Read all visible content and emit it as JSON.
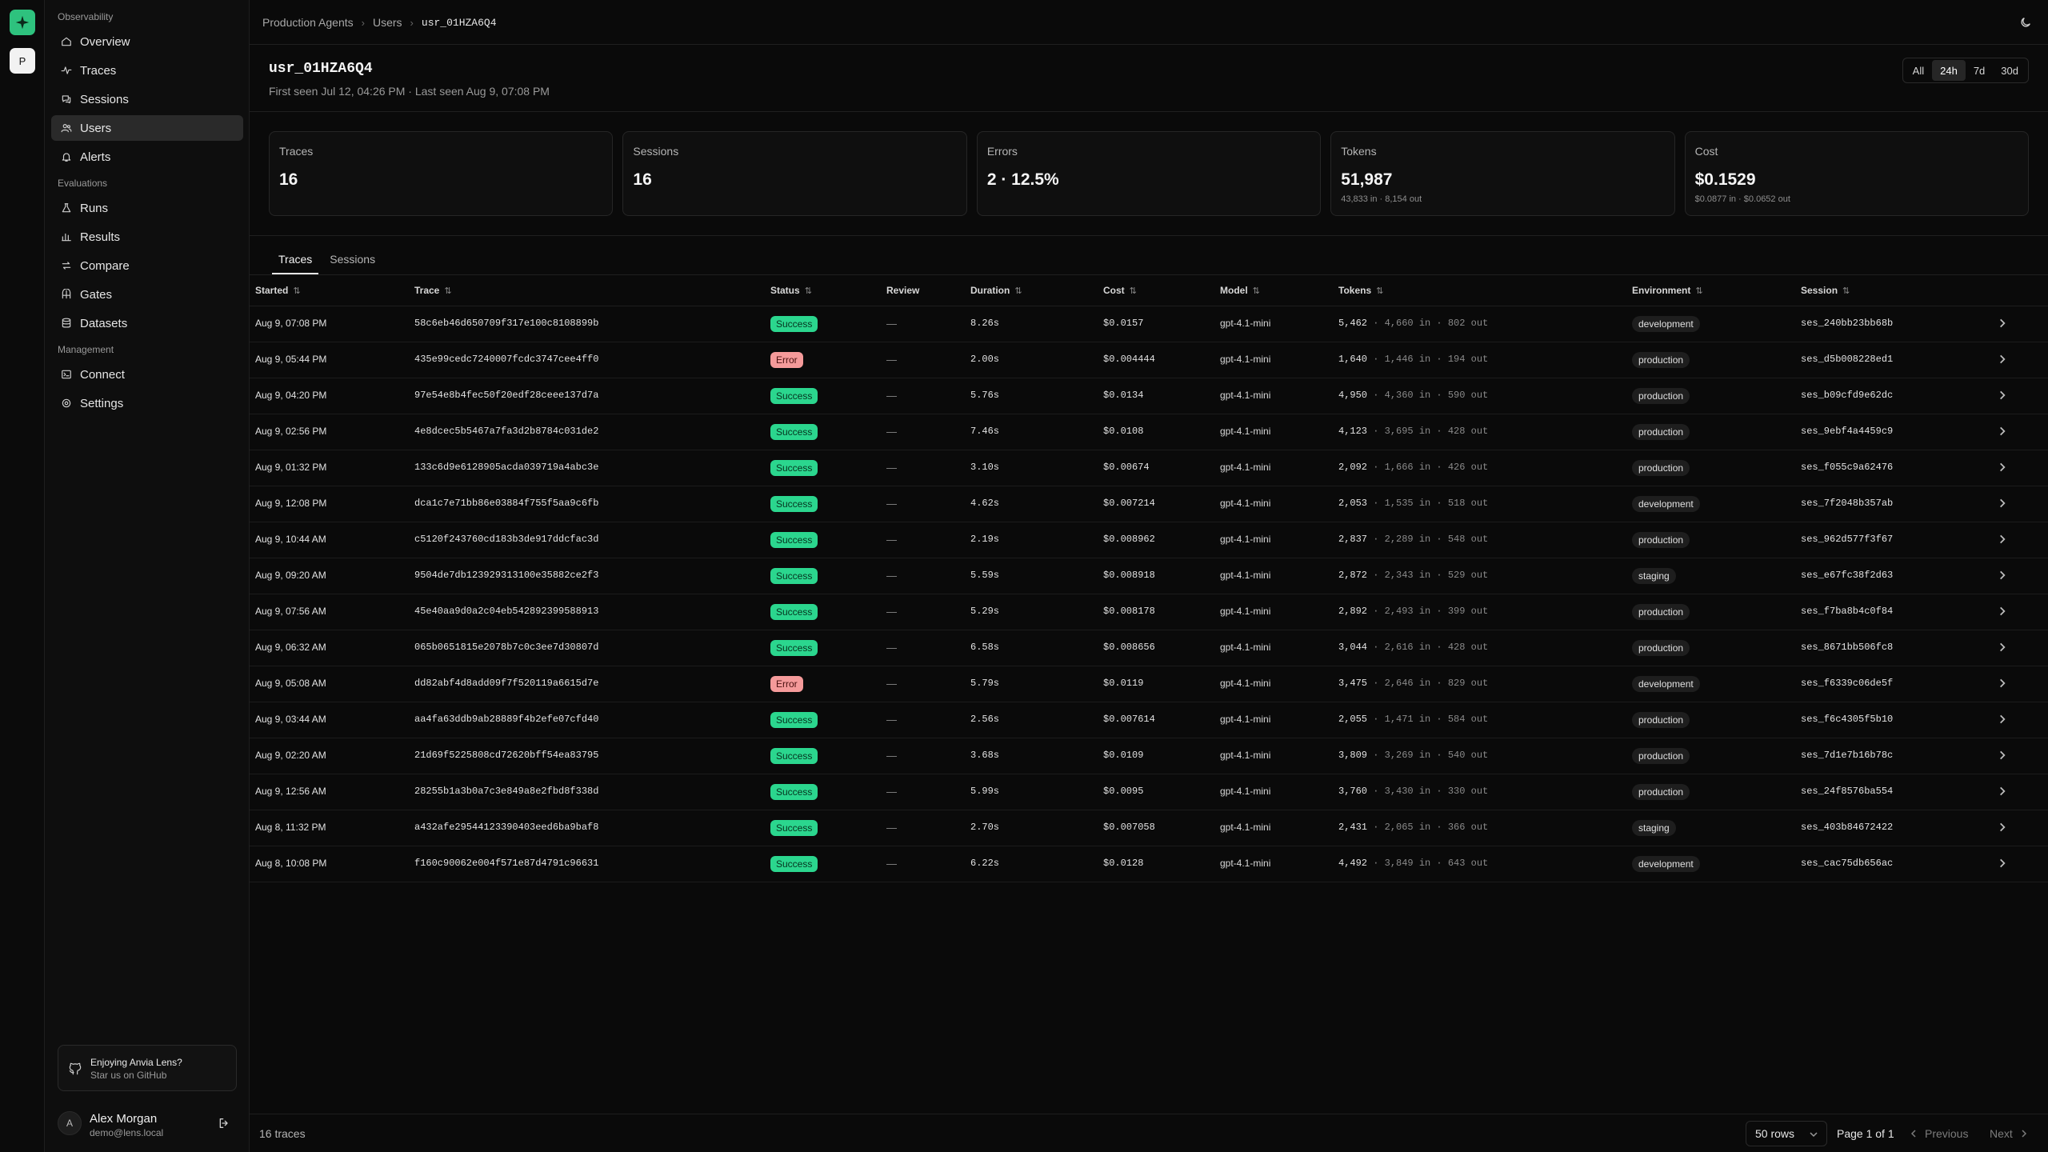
{
  "rail": {
    "project_initial": "P"
  },
  "sidebar": {
    "sections": [
      {
        "title": "Observability",
        "items": [
          {
            "label": "Overview",
            "icon": "home-icon"
          },
          {
            "label": "Traces",
            "icon": "activity-icon"
          },
          {
            "label": "Sessions",
            "icon": "chat-icon"
          },
          {
            "label": "Users",
            "icon": "users-icon",
            "active": true
          },
          {
            "label": "Alerts",
            "icon": "bell-icon"
          }
        ]
      },
      {
        "title": "Evaluations",
        "items": [
          {
            "label": "Runs",
            "icon": "flask-icon"
          },
          {
            "label": "Results",
            "icon": "bar-chart-icon"
          },
          {
            "label": "Compare",
            "icon": "compare-icon"
          },
          {
            "label": "Gates",
            "icon": "gate-icon"
          },
          {
            "label": "Datasets",
            "icon": "database-icon"
          }
        ]
      },
      {
        "title": "Management",
        "items": [
          {
            "label": "Connect",
            "icon": "terminal-icon"
          },
          {
            "label": "Settings",
            "icon": "gear-icon"
          }
        ]
      }
    ],
    "promo": {
      "title": "Enjoying Anvia Lens?",
      "subtitle": "Star us on GitHub"
    },
    "user": {
      "initial": "A",
      "name": "Alex Morgan",
      "email": "demo@lens.local"
    }
  },
  "breadcrumb": [
    "Production Agents",
    "Users",
    "usr_01HZA6Q4"
  ],
  "header": {
    "title": "usr_01HZA6Q4",
    "meta": "First seen Jul 12, 04:26 PM · Last seen Aug 9, 07:08 PM",
    "ranges": [
      "All",
      "24h",
      "7d",
      "30d"
    ],
    "selected_range": "24h"
  },
  "stats": [
    {
      "label": "Traces",
      "value": "16",
      "sub": ""
    },
    {
      "label": "Sessions",
      "value": "16",
      "sub": ""
    },
    {
      "label": "Errors",
      "value": "2 · 12.5%",
      "sub": ""
    },
    {
      "label": "Tokens",
      "value": "51,987",
      "sub": "43,833 in · 8,154 out"
    },
    {
      "label": "Cost",
      "value": "$0.1529",
      "sub": "$0.0877 in · $0.0652 out"
    }
  ],
  "tabs": [
    "Traces",
    "Sessions"
  ],
  "active_tab": "Traces",
  "table": {
    "columns": [
      {
        "label": "Started",
        "sortable": true
      },
      {
        "label": "Trace",
        "sortable": true
      },
      {
        "label": "Status",
        "sortable": true
      },
      {
        "label": "Review",
        "sortable": false
      },
      {
        "label": "Duration",
        "sortable": true
      },
      {
        "label": "Cost",
        "sortable": true
      },
      {
        "label": "Model",
        "sortable": true
      },
      {
        "label": "Tokens",
        "sortable": true
      },
      {
        "label": "Environment",
        "sortable": true
      },
      {
        "label": "Session",
        "sortable": true
      }
    ],
    "rows": [
      {
        "started": "Aug 9, 07:08 PM",
        "trace": "58c6eb46d650709f317e100c8108899b",
        "status": "Success",
        "review": "—",
        "duration": "8.26s",
        "cost": "$0.0157",
        "model": "gpt-4.1-mini",
        "tokens": "5,462",
        "tokens_in": "4,660 in",
        "tokens_out": "802 out",
        "environment": "development",
        "session": "ses_240bb23bb68b"
      },
      {
        "started": "Aug 9, 05:44 PM",
        "trace": "435e99cedc7240007fcdc3747cee4ff0",
        "status": "Error",
        "review": "—",
        "duration": "2.00s",
        "cost": "$0.004444",
        "model": "gpt-4.1-mini",
        "tokens": "1,640",
        "tokens_in": "1,446 in",
        "tokens_out": "194 out",
        "environment": "production",
        "session": "ses_d5b008228ed1"
      },
      {
        "started": "Aug 9, 04:20 PM",
        "trace": "97e54e8b4fec50f20edf28ceee137d7a",
        "status": "Success",
        "review": "—",
        "duration": "5.76s",
        "cost": "$0.0134",
        "model": "gpt-4.1-mini",
        "tokens": "4,950",
        "tokens_in": "4,360 in",
        "tokens_out": "590 out",
        "environment": "production",
        "session": "ses_b09cfd9e62dc"
      },
      {
        "started": "Aug 9, 02:56 PM",
        "trace": "4e8dcec5b5467a7fa3d2b8784c031de2",
        "status": "Success",
        "review": "—",
        "duration": "7.46s",
        "cost": "$0.0108",
        "model": "gpt-4.1-mini",
        "tokens": "4,123",
        "tokens_in": "3,695 in",
        "tokens_out": "428 out",
        "environment": "production",
        "session": "ses_9ebf4a4459c9"
      },
      {
        "started": "Aug 9, 01:32 PM",
        "trace": "133c6d9e6128905acda039719a4abc3e",
        "status": "Success",
        "review": "—",
        "duration": "3.10s",
        "cost": "$0.00674",
        "model": "gpt-4.1-mini",
        "tokens": "2,092",
        "tokens_in": "1,666 in",
        "tokens_out": "426 out",
        "environment": "production",
        "session": "ses_f055c9a62476"
      },
      {
        "started": "Aug 9, 12:08 PM",
        "trace": "dca1c7e71bb86e03884f755f5aa9c6fb",
        "status": "Success",
        "review": "—",
        "duration": "4.62s",
        "cost": "$0.007214",
        "model": "gpt-4.1-mini",
        "tokens": "2,053",
        "tokens_in": "1,535 in",
        "tokens_out": "518 out",
        "environment": "development",
        "session": "ses_7f2048b357ab"
      },
      {
        "started": "Aug 9, 10:44 AM",
        "trace": "c5120f243760cd183b3de917ddcfac3d",
        "status": "Success",
        "review": "—",
        "duration": "2.19s",
        "cost": "$0.008962",
        "model": "gpt-4.1-mini",
        "tokens": "2,837",
        "tokens_in": "2,289 in",
        "tokens_out": "548 out",
        "environment": "production",
        "session": "ses_962d577f3f67"
      },
      {
        "started": "Aug 9, 09:20 AM",
        "trace": "9504de7db123929313100e35882ce2f3",
        "status": "Success",
        "review": "—",
        "duration": "5.59s",
        "cost": "$0.008918",
        "model": "gpt-4.1-mini",
        "tokens": "2,872",
        "tokens_in": "2,343 in",
        "tokens_out": "529 out",
        "environment": "staging",
        "session": "ses_e67fc38f2d63"
      },
      {
        "started": "Aug 9, 07:56 AM",
        "trace": "45e40aa9d0a2c04eb542892399588913",
        "status": "Success",
        "review": "—",
        "duration": "5.29s",
        "cost": "$0.008178",
        "model": "gpt-4.1-mini",
        "tokens": "2,892",
        "tokens_in": "2,493 in",
        "tokens_out": "399 out",
        "environment": "production",
        "session": "ses_f7ba8b4c0f84"
      },
      {
        "started": "Aug 9, 06:32 AM",
        "trace": "065b0651815e2078b7c0c3ee7d30807d",
        "status": "Success",
        "review": "—",
        "duration": "6.58s",
        "cost": "$0.008656",
        "model": "gpt-4.1-mini",
        "tokens": "3,044",
        "tokens_in": "2,616 in",
        "tokens_out": "428 out",
        "environment": "production",
        "session": "ses_8671bb506fc8"
      },
      {
        "started": "Aug 9, 05:08 AM",
        "trace": "dd82abf4d8add09f7f520119a6615d7e",
        "status": "Error",
        "review": "—",
        "duration": "5.79s",
        "cost": "$0.0119",
        "model": "gpt-4.1-mini",
        "tokens": "3,475",
        "tokens_in": "2,646 in",
        "tokens_out": "829 out",
        "environment": "development",
        "session": "ses_f6339c06de5f"
      },
      {
        "started": "Aug 9, 03:44 AM",
        "trace": "aa4fa63ddb9ab28889f4b2efe07cfd40",
        "status": "Success",
        "review": "—",
        "duration": "2.56s",
        "cost": "$0.007614",
        "model": "gpt-4.1-mini",
        "tokens": "2,055",
        "tokens_in": "1,471 in",
        "tokens_out": "584 out",
        "environment": "production",
        "session": "ses_f6c4305f5b10"
      },
      {
        "started": "Aug 9, 02:20 AM",
        "trace": "21d69f5225808cd72620bff54ea83795",
        "status": "Success",
        "review": "—",
        "duration": "3.68s",
        "cost": "$0.0109",
        "model": "gpt-4.1-mini",
        "tokens": "3,809",
        "tokens_in": "3,269 in",
        "tokens_out": "540 out",
        "environment": "production",
        "session": "ses_7d1e7b16b78c"
      },
      {
        "started": "Aug 9, 12:56 AM",
        "trace": "28255b1a3b0a7c3e849a8e2fbd8f338d",
        "status": "Success",
        "review": "—",
        "duration": "5.99s",
        "cost": "$0.0095",
        "model": "gpt-4.1-mini",
        "tokens": "3,760",
        "tokens_in": "3,430 in",
        "tokens_out": "330 out",
        "environment": "production",
        "session": "ses_24f8576ba554"
      },
      {
        "started": "Aug 8, 11:32 PM",
        "trace": "a432afe29544123390403eed6ba9baf8",
        "status": "Success",
        "review": "—",
        "duration": "2.70s",
        "cost": "$0.007058",
        "model": "gpt-4.1-mini",
        "tokens": "2,431",
        "tokens_in": "2,065 in",
        "tokens_out": "366 out",
        "environment": "staging",
        "session": "ses_403b84672422"
      },
      {
        "started": "Aug 8, 10:08 PM",
        "trace": "f160c90062e004f571e87d4791c96631",
        "status": "Success",
        "review": "—",
        "duration": "6.22s",
        "cost": "$0.0128",
        "model": "gpt-4.1-mini",
        "tokens": "4,492",
        "tokens_in": "3,849 in",
        "tokens_out": "643 out",
        "environment": "development",
        "session": "ses_cac75db656ac"
      }
    ]
  },
  "footer": {
    "count": "16 traces",
    "rows_per_page": "50 rows",
    "page": "Page 1 of 1",
    "prev": "Previous",
    "next": "Next"
  },
  "colors": {
    "success": "#2bd68e",
    "error": "#f59a9a",
    "brand": "#2ec27e"
  }
}
